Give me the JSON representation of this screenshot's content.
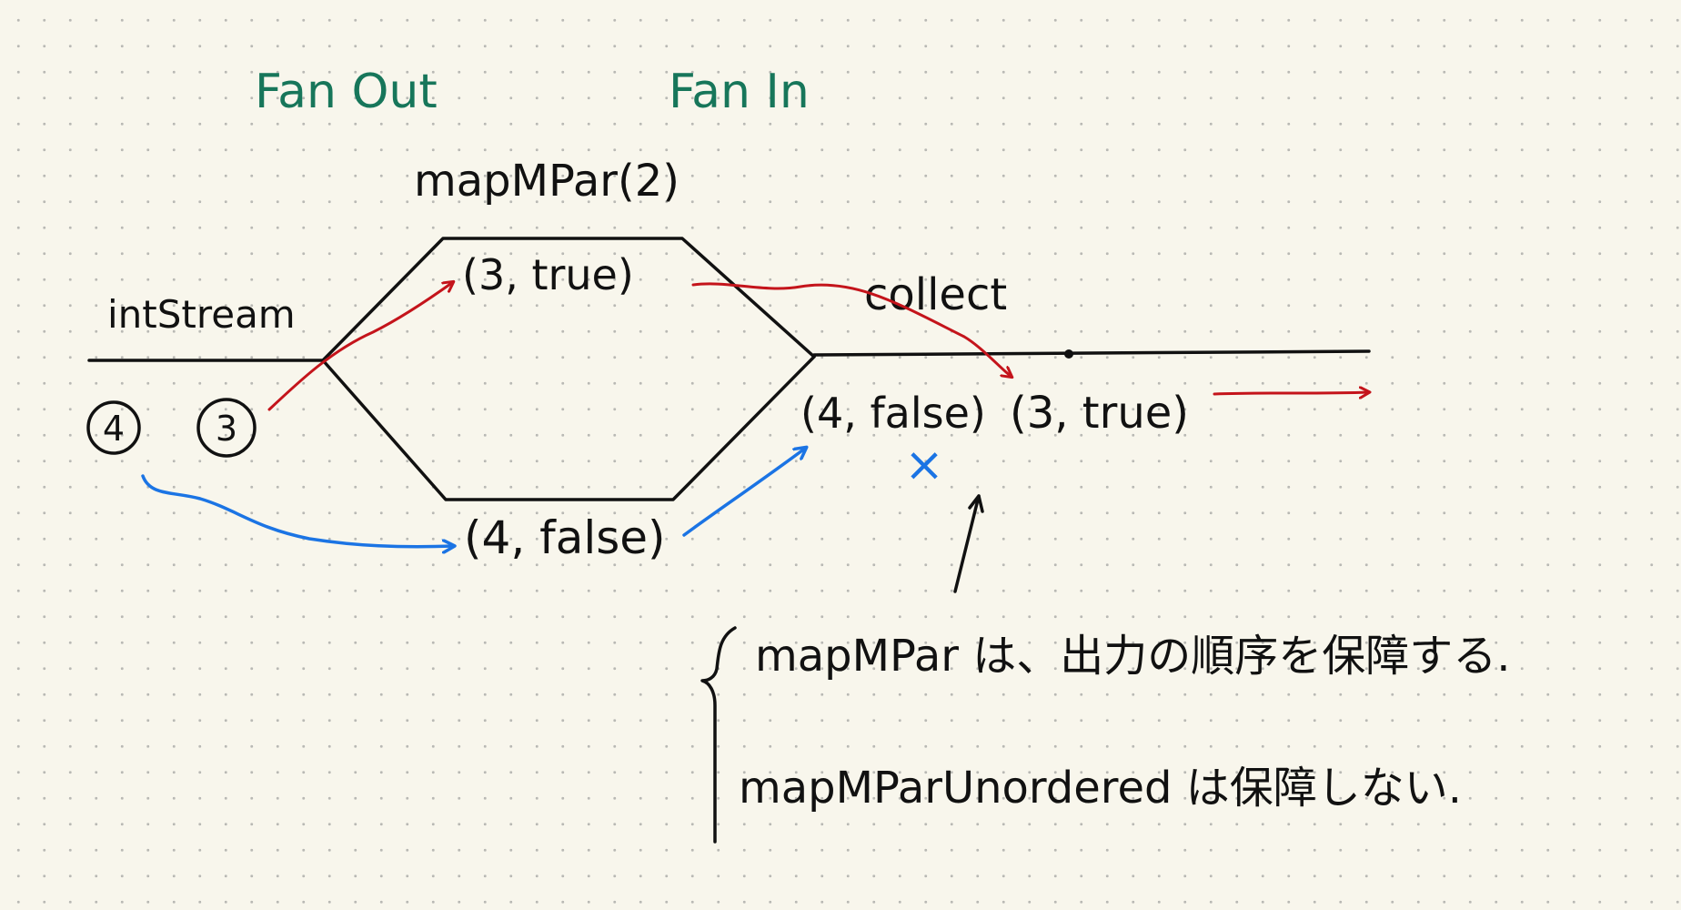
{
  "labels": {
    "fan_out": "Fan Out",
    "fan_in": "Fan In",
    "operator": "mapMPar(2)",
    "source": "intStream",
    "sink": "collect"
  },
  "elements": {
    "input_4": "4",
    "input_3": "3",
    "upper_lane_value": "(3, true)",
    "lower_lane_value": "(4, false)",
    "output_rejected": "(4, false)",
    "output_rejected_mark": "×",
    "output_emitted": "(3, true)"
  },
  "notes": {
    "ordered": "mapMPar は、出力の順序を保障する.",
    "unordered": "mapMParUnordered は保障しない."
  },
  "colors": {
    "ink": "#111111",
    "heading": "#17765a",
    "true_flow": "#c4141b",
    "false_flow": "#1b74e4",
    "background": "#f8f6ec"
  }
}
